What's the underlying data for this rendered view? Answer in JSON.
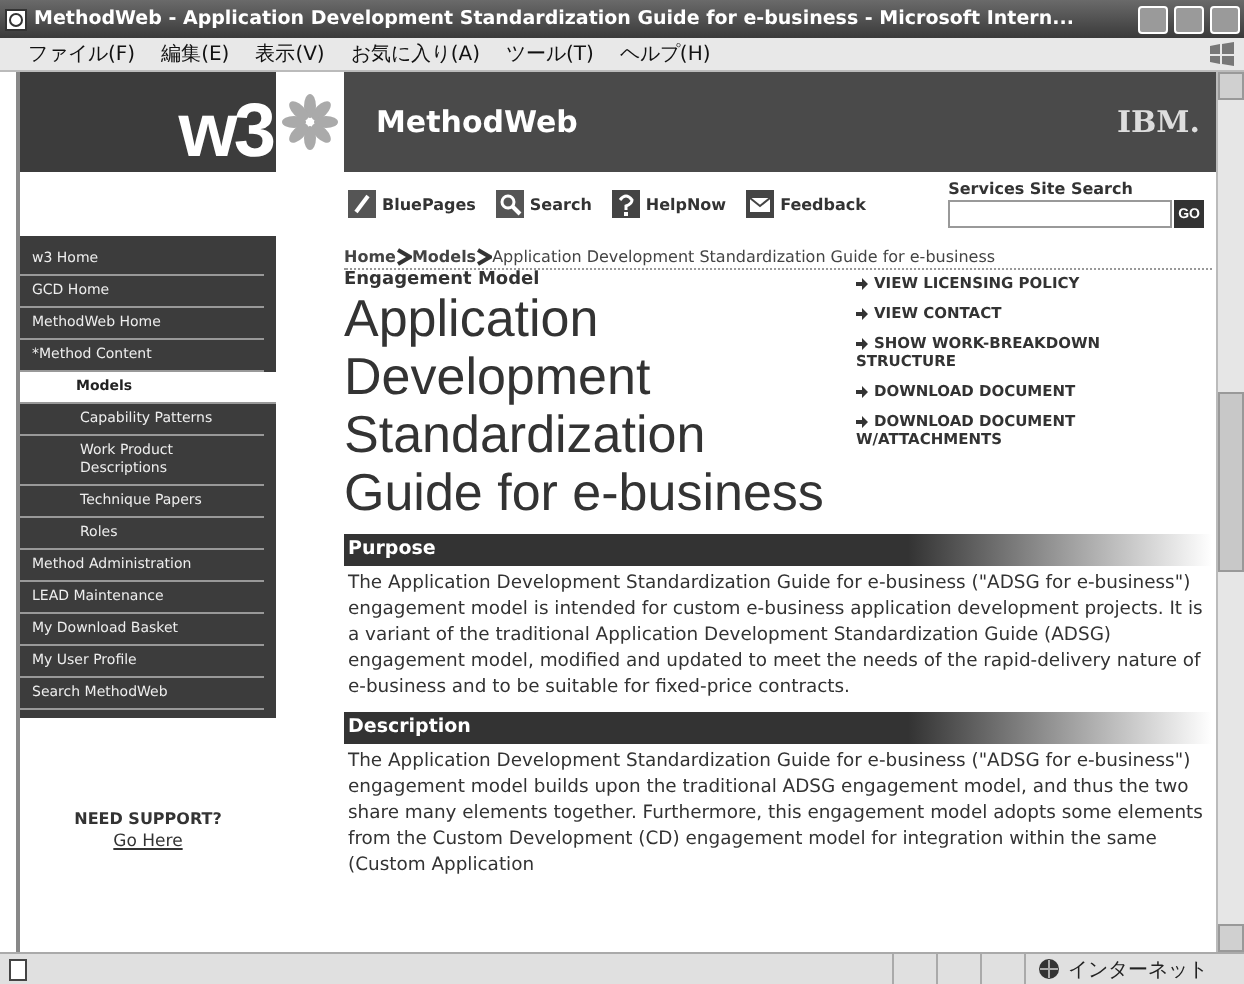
{
  "window": {
    "title": "MethodWeb - Application Development Standardization Guide for e-business - Microsoft Intern..."
  },
  "menu": [
    "ファイル(F)",
    "編集(E)",
    "表示(V)",
    "お気に入り(A)",
    "ツール(T)",
    "ヘルプ(H)"
  ],
  "header": {
    "logo": "w3",
    "site": "MethodWeb",
    "brand": "IBM."
  },
  "toolbar": [
    {
      "label": "BluePages",
      "kind": "pages"
    },
    {
      "label": "Search",
      "kind": "search"
    },
    {
      "label": "HelpNow",
      "kind": "help"
    },
    {
      "label": "Feedback",
      "kind": "mail"
    }
  ],
  "site_search": {
    "label": "Services Site Search",
    "button": "GO"
  },
  "nav": [
    {
      "label": "w3 Home",
      "selected": false
    },
    {
      "label": "GCD Home",
      "selected": false
    },
    {
      "label": "MethodWeb Home",
      "selected": false
    },
    {
      "label": "*Method Content",
      "selected": false,
      "children": [
        {
          "label": "Models",
          "selected": true
        },
        {
          "label": "Capability Patterns",
          "selected": false
        },
        {
          "label": "Work Product Descriptions",
          "selected": false
        },
        {
          "label": "Technique Papers",
          "selected": false
        },
        {
          "label": "Roles",
          "selected": false
        }
      ]
    },
    {
      "label": "Method Administration",
      "selected": false
    },
    {
      "label": "LEAD Maintenance",
      "selected": false
    },
    {
      "label": "My Download Basket",
      "selected": false
    },
    {
      "label": "My User Profile",
      "selected": false
    },
    {
      "label": "Search MethodWeb",
      "selected": false
    }
  ],
  "support": {
    "label": "NEED SUPPORT?",
    "link": "Go Here"
  },
  "breadcrumb": [
    "Home",
    "Models",
    "Application Development Standardization Guide for e-business"
  ],
  "subtitle": "Engagement Model",
  "title": "Application Development Standardization Guide for e-business",
  "actions": [
    "VIEW LICENSING POLICY",
    "VIEW CONTACT",
    "SHOW WORK-BREAKDOWN STRUCTURE",
    "DOWNLOAD DOCUMENT",
    "DOWNLOAD DOCUMENT W/ATTACHMENTS"
  ],
  "sections": [
    {
      "heading": "Purpose",
      "text": "The Application Development Standardization Guide for e-business (\"ADSG for e-business\") engagement model is intended for custom e-business application development projects. It is a variant of the traditional Application Development Standardization Guide (ADSG) engagement model, modified and updated to meet the needs of the rapid-delivery nature of e-business and to be suitable for fixed-price contracts."
    },
    {
      "heading": "Description",
      "text": "The Application Development Standardization Guide for e-business (\"ADSG for e-business\") engagement model builds upon the traditional ADSG engagement model, and thus the two share many elements together. Furthermore, this engagement model adopts some elements from the Custom Development (CD) engagement model for integration within the same (Custom Application"
    }
  ],
  "status_bar": {
    "zone": "インターネット"
  }
}
